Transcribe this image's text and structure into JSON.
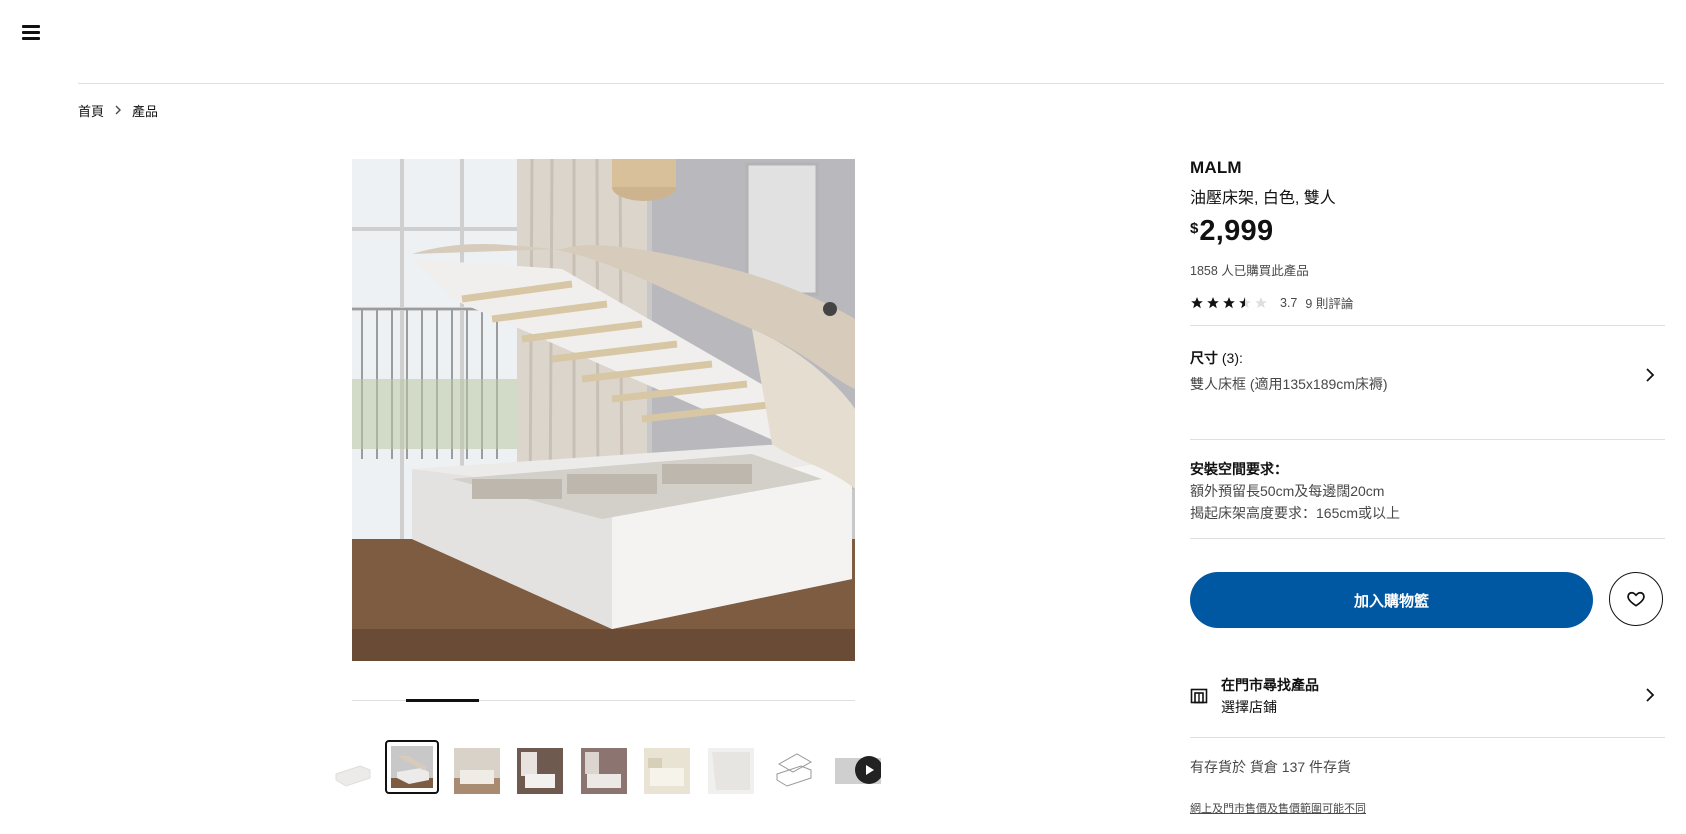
{
  "nav": {
    "menu_icon": "hamburger-menu-icon"
  },
  "breadcrumb": {
    "items": [
      "首頁",
      "產品"
    ],
    "separator_icon": "chevron-right-icon"
  },
  "gallery": {
    "main_image_alt": "MALM 油壓床架",
    "active_index": 1,
    "thumbnail_count": 9,
    "video_icon": "play-icon"
  },
  "product": {
    "brand": "MALM",
    "description": "油壓床架, 白色, 雙人",
    "currency": "$",
    "price": "2,999",
    "bought_count": "1858 人已購買此產品",
    "rating": 3.7,
    "rating_text": "3.7",
    "reviews": "9 則評論"
  },
  "size": {
    "label": "尺寸",
    "count": "(3):",
    "value": "雙人床框 (適用135x189cm床褥)"
  },
  "requirements": {
    "title": "安裝空間要求：",
    "line1": "額外預留長50cm及每邊闊20cm",
    "line2": "揭起床架高度要求：165cm或以上"
  },
  "actions": {
    "add_to_cart": "加入購物籃",
    "favourite_icon": "heart-icon"
  },
  "store": {
    "title": "在門市尋找產品",
    "subtitle": "選擇店鋪",
    "icon": "store-icon"
  },
  "stock": "有存貨於 貨倉 137 件存貨",
  "disclaimer": "網上及門市售價及售價範圍可能不同",
  "colors": {
    "primary": "#0058a3",
    "text": "#111111",
    "secondary_text": "#484848",
    "divider": "#dfdfdf"
  }
}
